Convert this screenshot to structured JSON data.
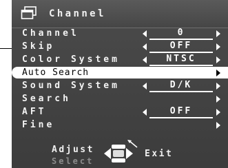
{
  "header": {
    "title": "Channel",
    "icon": "menu-window-icon"
  },
  "menu": {
    "items": [
      {
        "label": "Channel",
        "value": "0",
        "has_value": true
      },
      {
        "label": "Skip",
        "value": "OFF",
        "has_value": true
      },
      {
        "label": "Color System",
        "value": "NTSC",
        "has_value": true
      },
      {
        "label": "Auto Search",
        "value": "",
        "has_value": false,
        "selected": true
      },
      {
        "label": "Sound System",
        "value": "D/K",
        "has_value": true
      },
      {
        "label": "Search",
        "value": "",
        "has_value": false
      },
      {
        "label": "AFT",
        "value": "OFF",
        "has_value": true
      },
      {
        "label": "Fine",
        "value": "",
        "has_value": false
      }
    ]
  },
  "footer": {
    "adjust_label": "Adjust",
    "select_label": "Select",
    "exit_label": "Exit",
    "nav_icon": "dpad-icon"
  },
  "colors": {
    "panel_bg": "#444444",
    "text": "#ffffff",
    "selected_bg": "#ffffff",
    "selected_text": "#000000",
    "hint_text": "#8c8c8c"
  }
}
